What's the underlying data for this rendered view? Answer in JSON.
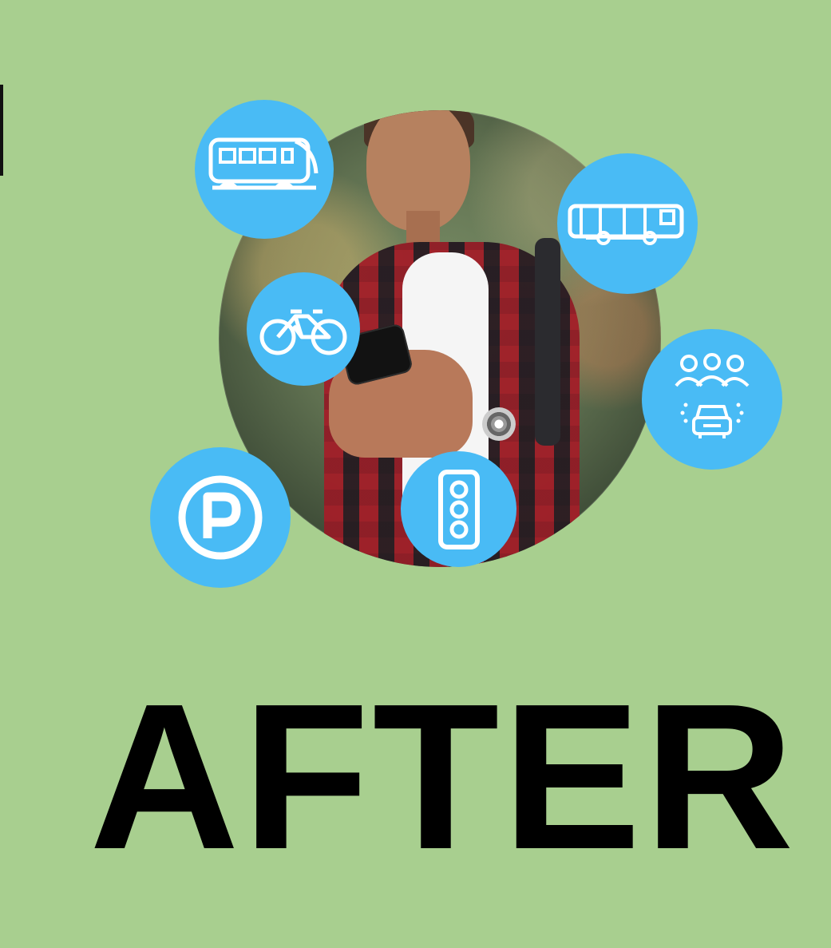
{
  "background": {
    "color": "#a8cf8f"
  },
  "hero": {
    "title": "AFTER"
  },
  "icons": [
    "train-icon",
    "bus-icon",
    "bike-icon",
    "carpool-icon",
    "parking-icon",
    "traffic-light-icon"
  ],
  "colors": {
    "accent_blue": "#49bbf5",
    "title_text": "#000000"
  }
}
